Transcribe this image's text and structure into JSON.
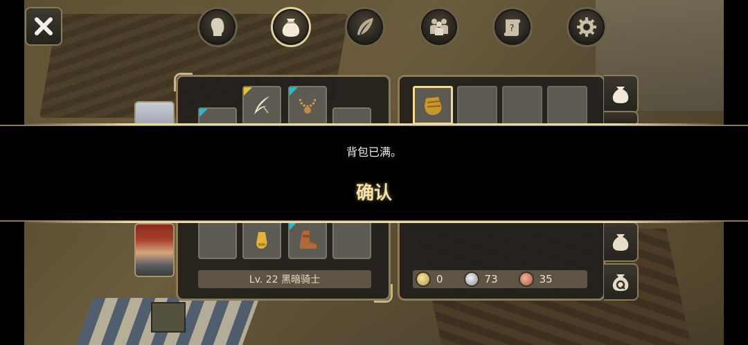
{
  "tabs": [
    {
      "name": "character-tab",
      "icon": "head-icon",
      "active": false
    },
    {
      "name": "inventory-tab",
      "icon": "bag-icon",
      "active": true
    },
    {
      "name": "skills-tab",
      "icon": "feather-icon",
      "active": false
    },
    {
      "name": "party-tab",
      "icon": "group-icon",
      "active": false
    },
    {
      "name": "quests-tab",
      "icon": "scroll-icon",
      "active": false
    },
    {
      "name": "settings-tab",
      "icon": "gear-icon",
      "active": false
    }
  ],
  "equipment": {
    "character_label": "Lv. 22 黑暗骑士",
    "slots": [
      "feather-icon",
      "necklace-icon",
      "ring-icon",
      "gloves-icon",
      "boots-icon"
    ]
  },
  "currency": {
    "gold": "0",
    "silver": "73",
    "copper": "35"
  },
  "dialog": {
    "message": "背包已满。",
    "confirm_label": "确认"
  },
  "colors": {
    "accent_gold": "#f6e2a6",
    "frame": "#8c7a58",
    "rarity_teal": "#2fb8c6",
    "rarity_gold": "#e6c233"
  }
}
